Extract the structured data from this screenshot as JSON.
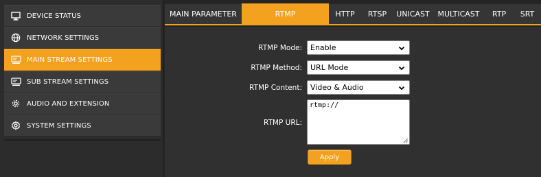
{
  "sidebar": {
    "items": [
      {
        "label": "DEVICE STATUS",
        "icon": "monitor-icon"
      },
      {
        "label": "NETWORK SETTINGS",
        "icon": "globe-icon"
      },
      {
        "label": "MAIN STREAM SETTINGS",
        "icon": "stream-icon"
      },
      {
        "label": "SUB STREAM SETTINGS",
        "icon": "stream-icon"
      },
      {
        "label": "AUDIO AND EXTENSION",
        "icon": "gear-icon"
      },
      {
        "label": "SYSTEM SETTINGS",
        "icon": "settings-icon"
      }
    ],
    "active_index": 2
  },
  "tabs": [
    {
      "label": "MAIN PARAMETER"
    },
    {
      "label": "RTMP"
    },
    {
      "label": "HTTP"
    },
    {
      "label": "RTSP"
    },
    {
      "label": "UNICAST"
    },
    {
      "label": "MULTICAST"
    },
    {
      "label": "RTP"
    },
    {
      "label": "SRT"
    }
  ],
  "active_tab": "RTMP",
  "form": {
    "mode_label": "RTMP Mode:",
    "mode_value": "Enable",
    "method_label": "RTMP Method:",
    "method_value": "URL Mode",
    "content_label": "RTMP Content:",
    "content_value": "Video & Audio",
    "url_label": "RTMP URL:",
    "url_value": "rtmp://",
    "apply_label": "Apply"
  },
  "colors": {
    "accent": "#f3a21f",
    "background": "#252525",
    "panel": "#303030"
  }
}
